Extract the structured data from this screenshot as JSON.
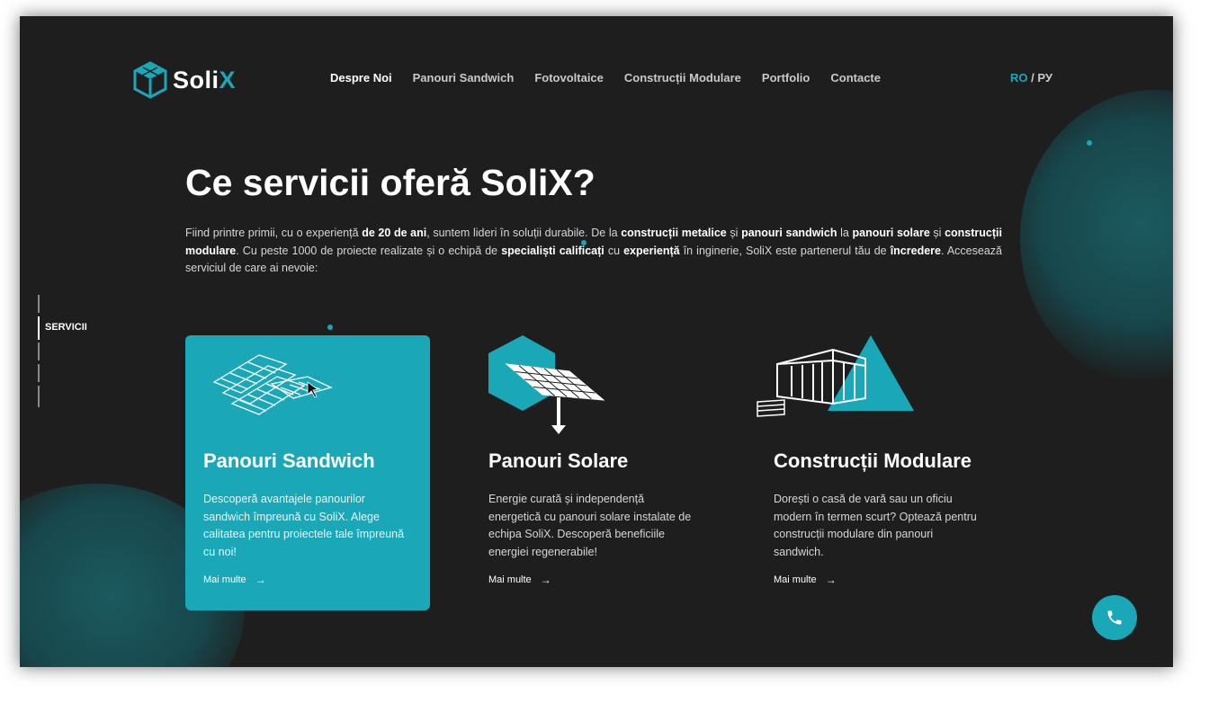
{
  "brand": {
    "logo_prefix": "Soli",
    "logo_suffix": "X",
    "accent": "#1aa7b8"
  },
  "nav": {
    "items": [
      {
        "label": "Despre Noi",
        "active": true
      },
      {
        "label": "Panouri Sandwich"
      },
      {
        "label": "Fotovoltaice"
      },
      {
        "label": "Construcții Modulare"
      },
      {
        "label": "Portfolio"
      },
      {
        "label": "Contacte"
      }
    ]
  },
  "lang": {
    "ro": "RO",
    "separator": "/",
    "ru": "РУ"
  },
  "side_rail": {
    "label": "SERVICII"
  },
  "heading": "Ce servicii oferă SoliX?",
  "intro": {
    "t1": "Fiind printre primii, cu o experiență ",
    "b1": "de 20 de ani",
    "t2": ", suntem lideri în soluții durabile. De la ",
    "b2": "construcții metalice",
    "t3": " și ",
    "b3": "panouri sandwich",
    "t4": " la ",
    "b4": "panouri solare",
    "t5": " și ",
    "b5": "construcții modulare",
    "t6": ". Cu peste 1000 de proiecte realizate și o echipă de ",
    "b6": "specialiști calificați",
    "t7": " cu ",
    "b7": "experiență",
    "t8": " în inginerie, SoliX este partenerul tău de ",
    "b8": "încredere",
    "t9": ". Accesează serviciul de care ai nevoie:"
  },
  "cards": [
    {
      "title": "Panouri Sandwich",
      "desc": "Descoperă avantajele panourilor sandwich împreună cu SoliX. Alege calitatea pentru proiectele tale împreună cu noi!",
      "more": "Mai multe",
      "arrow": "→",
      "icon": "sandwich-panels-icon"
    },
    {
      "title": "Panouri Solare",
      "desc": "Energie curată și independență energetică cu panouri solare instalate de echipa SoliX. Descoperă beneficiile energiei regenerabile!",
      "more": "Mai multe",
      "arrow": "→",
      "icon": "solar-panel-icon"
    },
    {
      "title": "Construcții Modulare",
      "desc": "Dorești o casă de vară sau un oficiu modern în termen scurt? Optează pentru construcții modulare din panouri sandwich.",
      "more": "Mai multe",
      "arrow": "→",
      "icon": "modular-house-icon"
    }
  ],
  "call_button": {
    "icon": "phone-icon"
  }
}
